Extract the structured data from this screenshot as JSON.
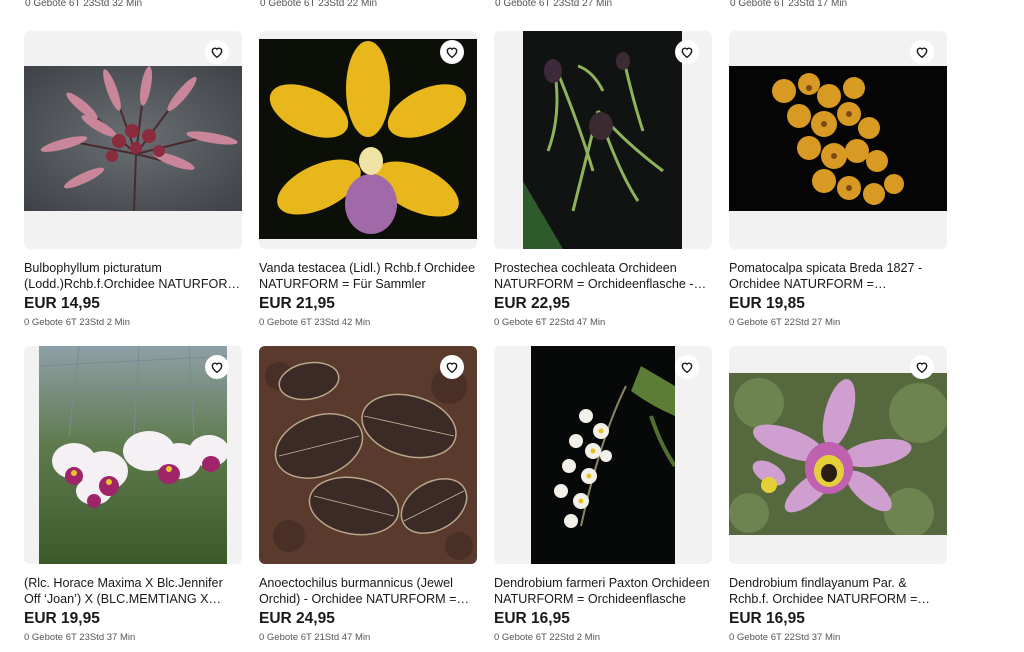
{
  "previous_row_meta": [
    "0 Gebote 6T 23Std 32 Min",
    "0 Gebote 6T 23Std 22 Min",
    "0 Gebote 6T 23Std 27 Min",
    "0 Gebote 6T 23Std 17 Min"
  ],
  "items": [
    {
      "title": "Bulbophyllum picturatum (Lodd.)Rchb.f.Orchidee NATURFORM = Orchideenflasche",
      "price": "EUR 14,95",
      "meta": "0 Gebote 6T 23Std 2 Min",
      "image": "bulbophyllum-photo"
    },
    {
      "title": "Vanda testacea (Lidl.) Rchb.f Orchidee NATURFORM = Für Sammler",
      "price": "EUR 21,95",
      "meta": "0 Gebote 6T 23Std 42 Min",
      "image": "vanda-photo"
    },
    {
      "title": "Prostechea cochleata Orchideen NATURFORM = Orchideenflasche - Sammler",
      "price": "EUR 22,95",
      "meta": "0 Gebote 6T 22Std 47 Min",
      "image": "prosthechea-photo"
    },
    {
      "title": "Pomatocalpa spicata Breda 1827 - Orchidee NATURFORM = Orchideenflasche",
      "price": "EUR 19,85",
      "meta": "0 Gebote 6T 22Std 27 Min",
      "image": "pomatocalpa-photo"
    },
    {
      "title": "(Rlc. Horace Maxima X Blc.Jennifer Off ‘Joan’) X (BLC.MEMTIANG X Orchideenflasche)",
      "price": "EUR 19,95",
      "meta": "0 Gebote 6T 23Std 37 Min",
      "image": "cattleya-photo"
    },
    {
      "title": "Anoectochilus burmannicus (Jewel Orchid) - Orchidee NATURFORM = Orchideenflasche",
      "price": "EUR 24,95",
      "meta": "0 Gebote 6T 21Std 47 Min",
      "image": "anoectochilus-photo"
    },
    {
      "title": "Dendrobium farmeri Paxton Orchideen NATURFORM = Orchideenflasche",
      "price": "EUR 16,95",
      "meta": "0 Gebote 6T 22Std 2 Min",
      "image": "dendrobium-farmeri-photo"
    },
    {
      "title": "Dendrobium findlayanum Par. & Rchb.f. Orchidee NATURFORM = Orchideenflasche",
      "price": "EUR 16,95",
      "meta": "0 Gebote 6T 22Std 37 Min",
      "image": "dendrobium-findlayanum-photo"
    }
  ],
  "icons": {
    "watch": "heart-icon"
  },
  "colors": {
    "text": "#191919",
    "meta": "#555555",
    "image_bg": "#f2f2f2"
  }
}
